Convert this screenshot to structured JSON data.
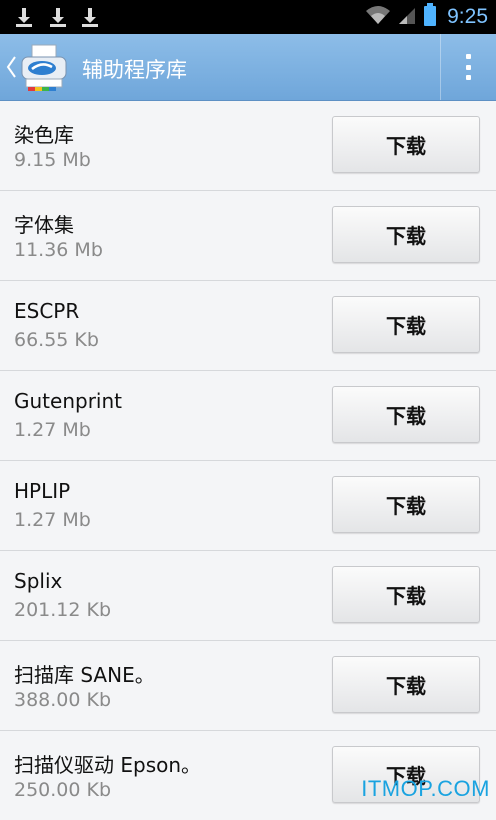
{
  "status_bar": {
    "time": "9:25",
    "download_icons": [
      "download-icon",
      "download-icon",
      "download-icon"
    ],
    "icons": [
      "wifi-icon",
      "signal-icon",
      "battery-icon"
    ]
  },
  "action_bar": {
    "title": "辅助程序库",
    "back_icon": "chevron-left-icon",
    "app_icon": "printer-app-icon",
    "menu_icon": "overflow-menu-icon"
  },
  "list": {
    "items": [
      {
        "name": "染色库",
        "size": "9.15 Mb",
        "button": "下载"
      },
      {
        "name": "字体集",
        "size": "11.36 Mb",
        "button": "下载"
      },
      {
        "name": "ESCPR",
        "size": "66.55 Kb",
        "button": "下载"
      },
      {
        "name": "Gutenprint",
        "size": "1.27 Mb",
        "button": "下载"
      },
      {
        "name": "HPLIP",
        "size": "1.27 Mb",
        "button": "下载"
      },
      {
        "name": "Splix",
        "size": "201.12 Kb",
        "button": "下载"
      },
      {
        "name": "扫描库 SANE。",
        "size": "388.00 Kb",
        "button": "下载"
      },
      {
        "name": "扫描仪驱动 Epson。",
        "size": "250.00 Kb",
        "button": "下载"
      }
    ]
  },
  "watermark": "ITMOP.COM",
  "colors": {
    "action_bar": "#7fb1e0",
    "time": "#7fc3ff",
    "watermark": "#1aa3e0"
  }
}
